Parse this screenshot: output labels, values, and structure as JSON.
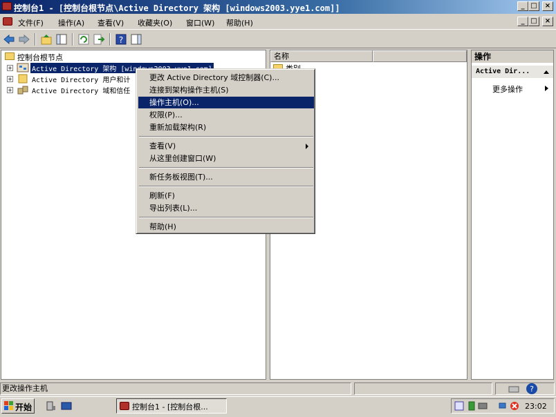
{
  "window": {
    "title": "控制台1 - [控制台根节点\\Active Directory 架构 [windows2003.yye1.com]]",
    "controls": {
      "minimize": "_",
      "maximize": "□",
      "close": "×"
    }
  },
  "menubar": {
    "items": [
      "文件(F)",
      "操作(A)",
      "查看(V)",
      "收藏夹(O)",
      "窗口(W)",
      "帮助(H)"
    ]
  },
  "tree": {
    "root": "控制台根节点",
    "items": [
      {
        "label": "Active Directory 架构 [windows2003.yye1.com]",
        "selected": true
      },
      {
        "label": "Active Directory 用户和计"
      },
      {
        "label": "Active Directory 域和信任"
      }
    ]
  },
  "list": {
    "columns": [
      "名称",
      ""
    ],
    "rows": [
      "类别"
    ]
  },
  "actions": {
    "header": "操作",
    "section": "Active Dir...",
    "more": "更多操作"
  },
  "context_menu": {
    "items": [
      {
        "label": "更改 Active Directory 域控制器(C)...",
        "type": "item"
      },
      {
        "label": "连接到架构操作主机(S)",
        "type": "item"
      },
      {
        "label": "操作主机(O)...",
        "type": "item",
        "highlighted": true
      },
      {
        "label": "权限(P)...",
        "type": "item"
      },
      {
        "label": "重新加载架构(R)",
        "type": "item"
      },
      {
        "type": "separator"
      },
      {
        "label": "查看(V)",
        "type": "submenu"
      },
      {
        "label": "从这里创建窗口(W)",
        "type": "item"
      },
      {
        "type": "separator"
      },
      {
        "label": "新任务板视图(T)...",
        "type": "item"
      },
      {
        "type": "separator"
      },
      {
        "label": "刷新(F)",
        "type": "item"
      },
      {
        "label": "导出列表(L)...",
        "type": "item"
      },
      {
        "type": "separator"
      },
      {
        "label": "帮助(H)",
        "type": "item"
      }
    ]
  },
  "statusbar": {
    "text": "更改操作主机"
  },
  "taskbar": {
    "start": "开始",
    "task": "控制台1 - [控制台根...",
    "clock": "23:02"
  },
  "colors": {
    "selection": "#0a246a",
    "face": "#d4d0c8"
  }
}
